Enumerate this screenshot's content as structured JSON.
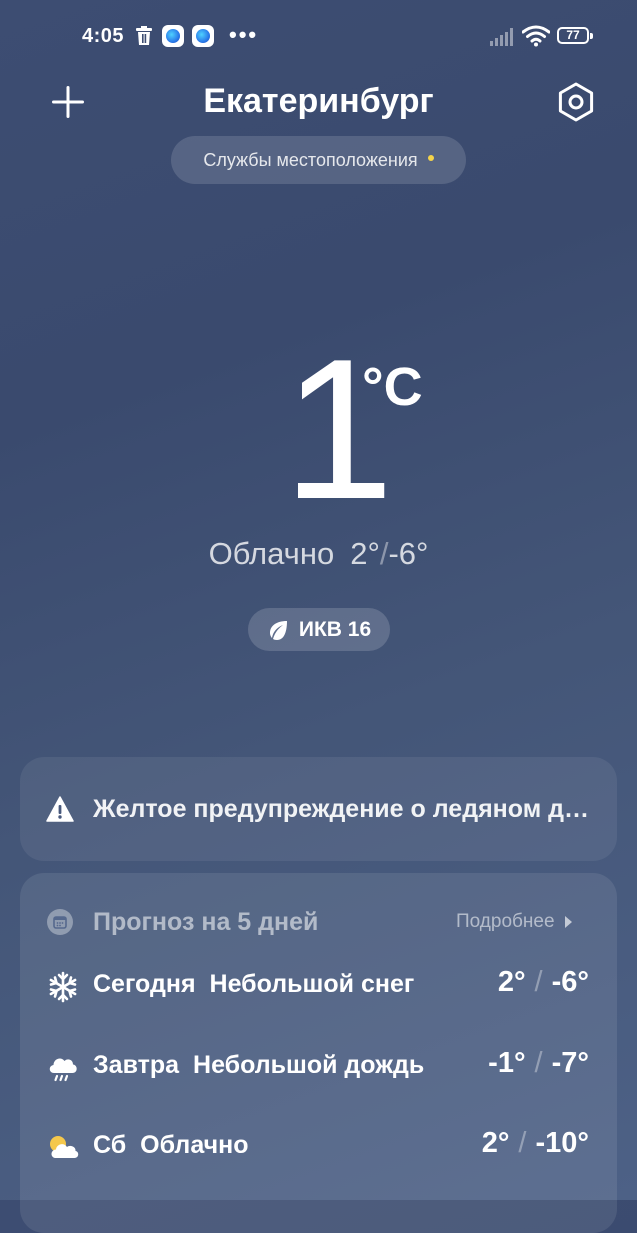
{
  "status_bar": {
    "time": "4:05",
    "more": "•••",
    "battery": "77"
  },
  "header": {
    "city": "Екатеринбург",
    "location_pill": "Службы местоположения"
  },
  "current": {
    "temp": "1",
    "unit": "°C",
    "condition": "Облачно",
    "high": "2°",
    "low": "-6°",
    "aqi_label": "ИКВ 16"
  },
  "alert": {
    "text": "Желтое предупреждение о ледяном дожде"
  },
  "forecast": {
    "title": "Прогноз на 5 дней",
    "more_label": "Подробнее",
    "days": [
      {
        "day": "Сегодня",
        "desc": "Небольшой снег",
        "high": "2°",
        "low": "-6°",
        "icon": "snowflake-icon"
      },
      {
        "day": "Завтра",
        "desc": "Небольшой дождь",
        "high": "-1°",
        "low": "-7°",
        "icon": "rain-cloud-icon"
      },
      {
        "day": "Сб",
        "desc": "Облачно",
        "high": "2°",
        "low": "-10°",
        "icon": "partly-cloudy-icon"
      }
    ]
  },
  "colors": {
    "background_top": "#3d4d72",
    "background_bottom": "#4d6186",
    "location_dot": "#f5d44a"
  }
}
